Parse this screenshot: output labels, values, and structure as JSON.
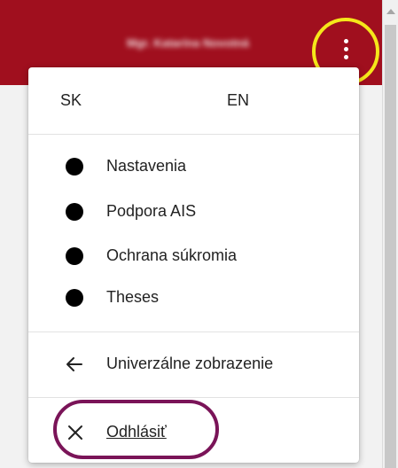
{
  "header": {
    "user_name": "Mgr. Katarína Novotná",
    "menu_icon": "more-vert-icon",
    "highlight_color": "#f5e71a",
    "background_color": "#a00f1e"
  },
  "menu": {
    "languages": [
      "SK",
      "EN"
    ],
    "items": [
      {
        "label": "Nastavenia",
        "icon": "bullet-icon"
      },
      {
        "label": "Podpora AIS",
        "icon": "bullet-icon"
      },
      {
        "label": "Ochrana súkromia",
        "icon": "bullet-icon"
      },
      {
        "label": "Theses",
        "icon": "bullet-icon"
      }
    ],
    "universal_view": {
      "label": "Univerzálne zobrazenie",
      "icon": "arrow-left-icon"
    },
    "logout": {
      "label": "Odhlásiť",
      "icon": "close-icon",
      "highlight_color": "#7a1458"
    }
  }
}
